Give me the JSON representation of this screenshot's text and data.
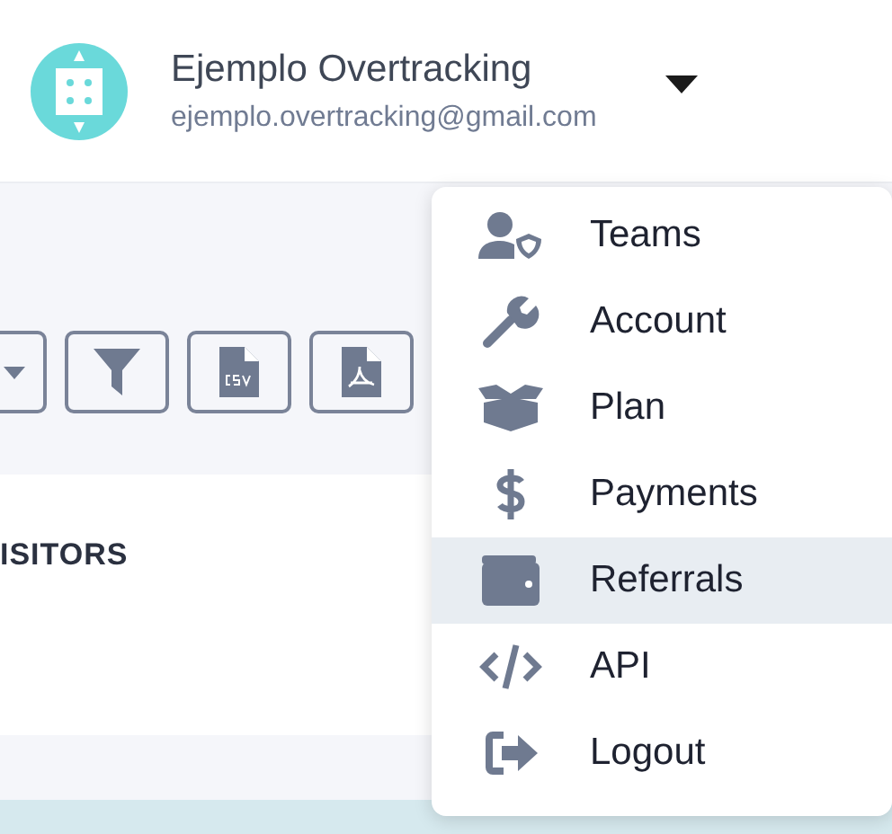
{
  "user": {
    "name": "Ejemplo Overtracking",
    "email": "ejemplo.overtracking@gmail.com"
  },
  "toolbar": [
    {
      "kind": "dropdown"
    },
    {
      "kind": "filter"
    },
    {
      "kind": "csv"
    },
    {
      "kind": "pdf"
    }
  ],
  "card": {
    "label": "ISITORS"
  },
  "menu": [
    {
      "label": "Teams",
      "kind": "teams",
      "selected": false
    },
    {
      "label": "Account",
      "kind": "account",
      "selected": false
    },
    {
      "label": "Plan",
      "kind": "plan",
      "selected": false
    },
    {
      "label": "Payments",
      "kind": "payments",
      "selected": false
    },
    {
      "label": "Referrals",
      "kind": "referrals",
      "selected": true
    },
    {
      "label": "API",
      "kind": "api",
      "selected": false
    },
    {
      "label": "Logout",
      "kind": "logout",
      "selected": false
    }
  ]
}
